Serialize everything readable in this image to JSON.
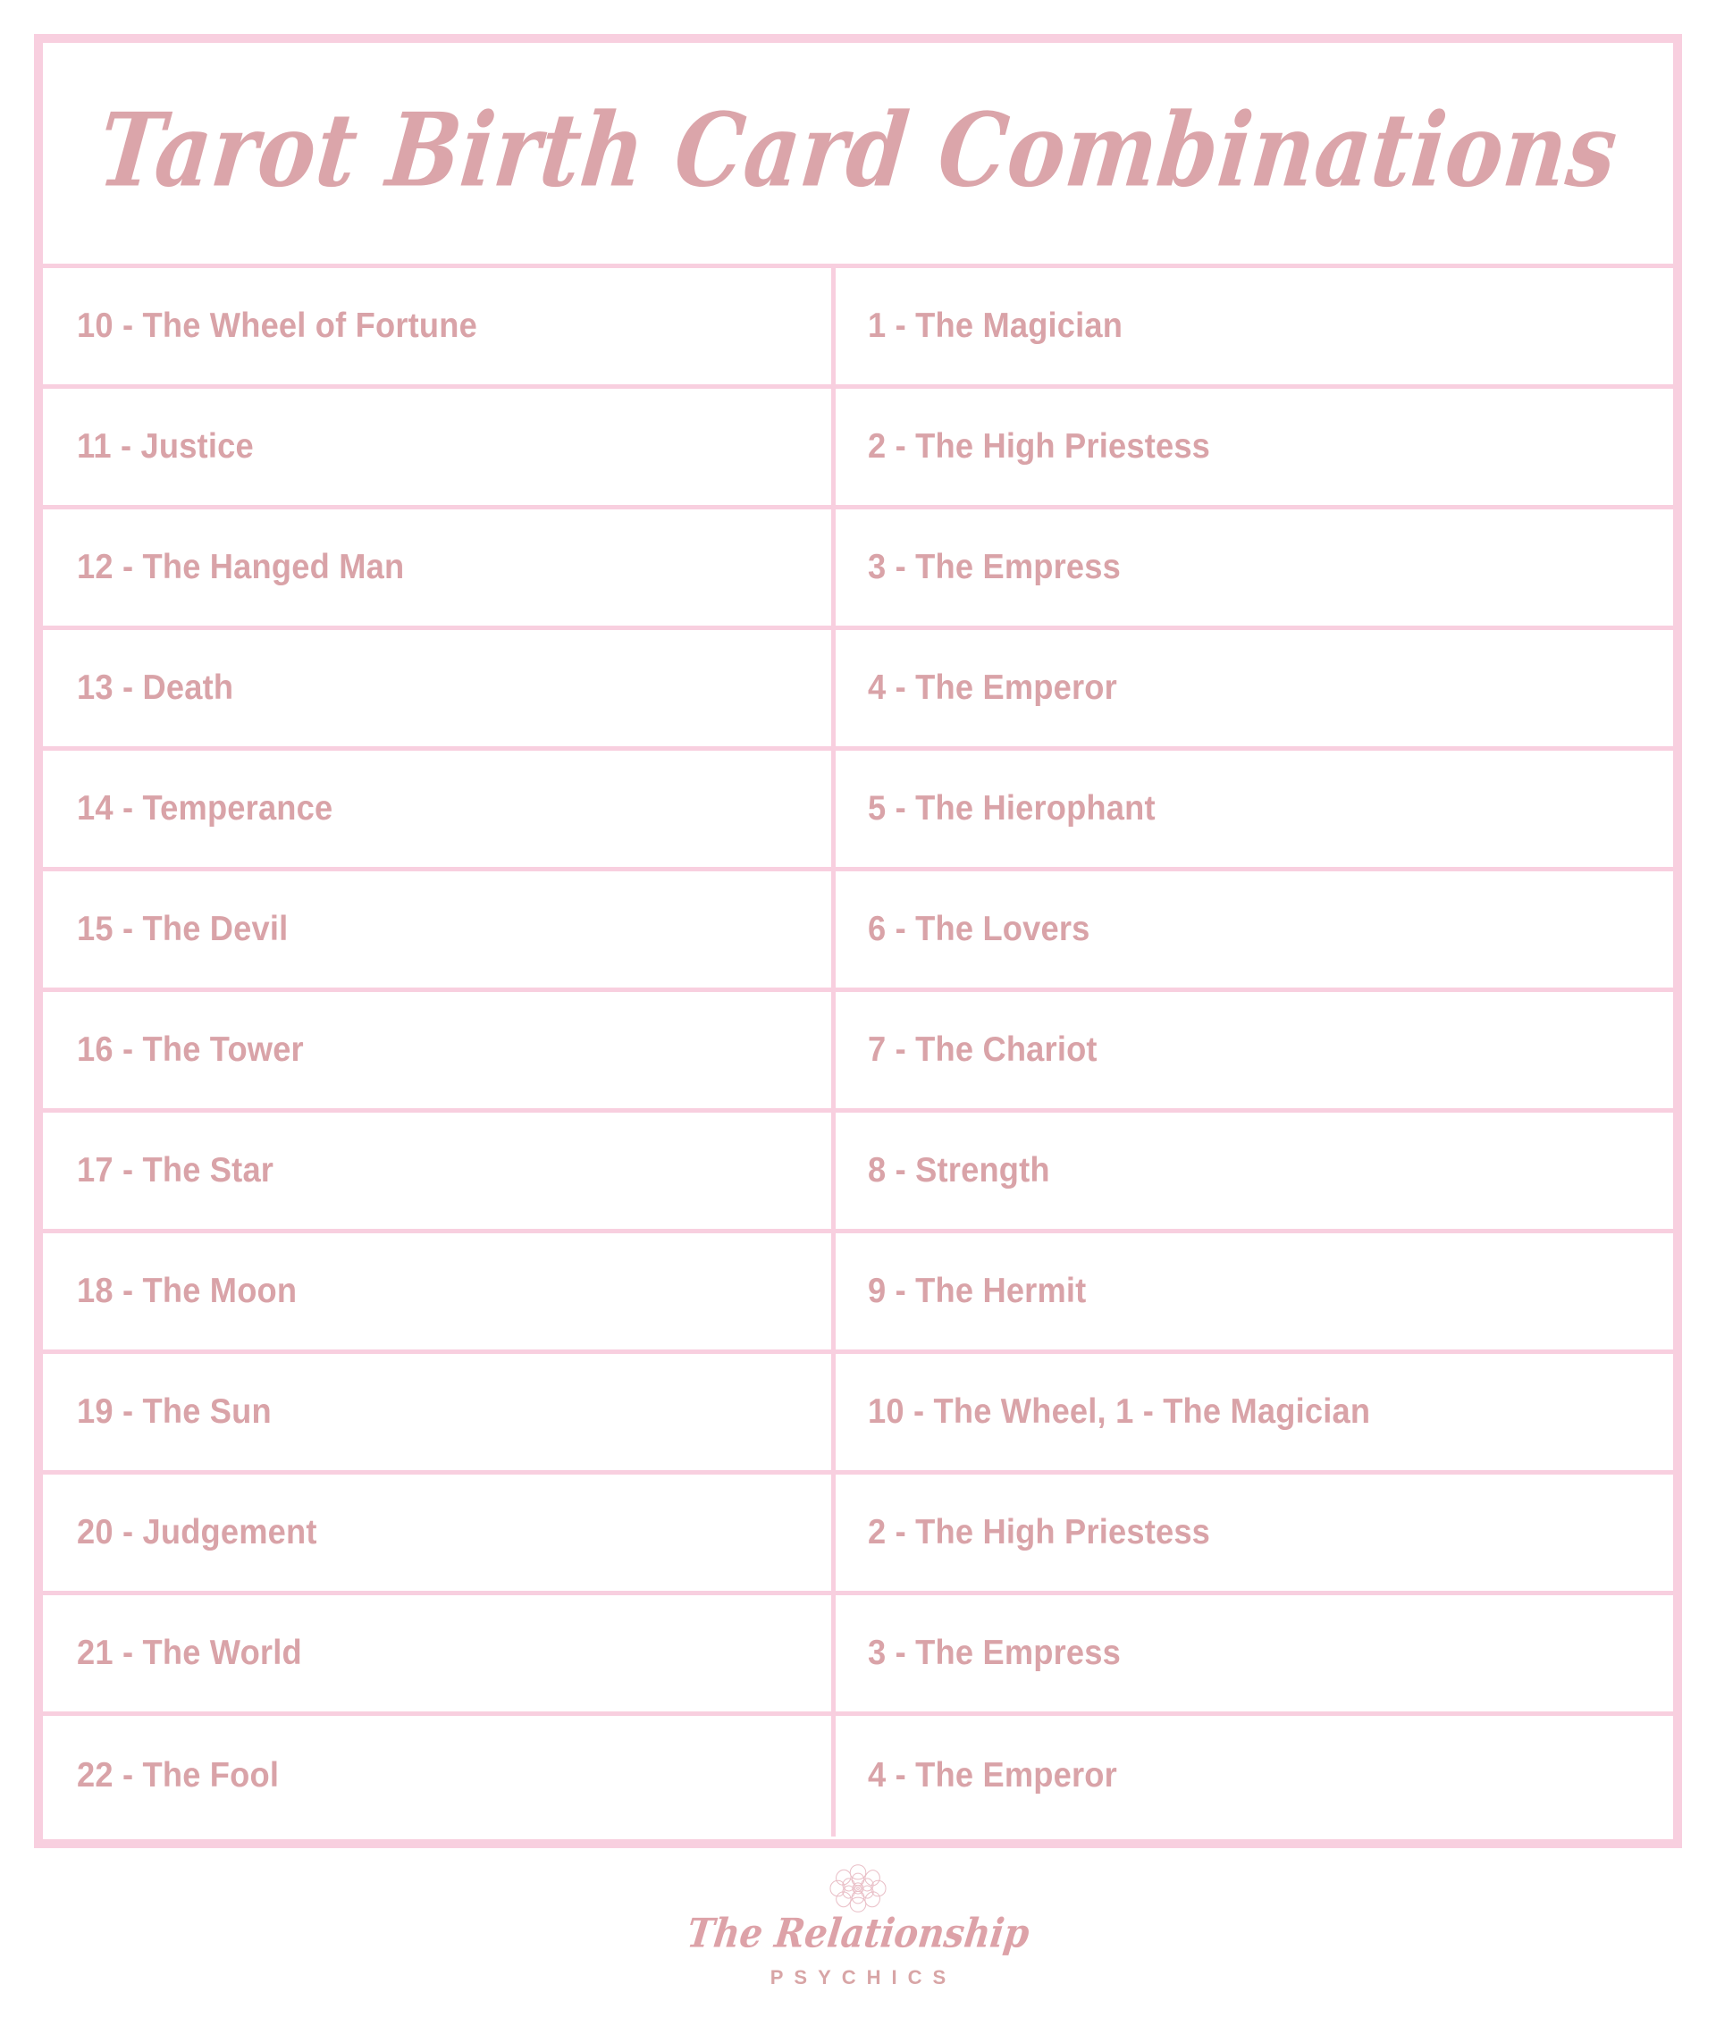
{
  "page": {
    "background_color": "#ffffff",
    "border_color": "#f8cfdf",
    "text_color": "#d9a3a8",
    "title": "Tarot Birth Card Combinations"
  },
  "table": {
    "rows": [
      {
        "left": "10 - The Wheel of Fortune",
        "right": "1 - The Magician"
      },
      {
        "left": "11 - Justice",
        "right": "2 - The High Priestess"
      },
      {
        "left": "12 - The Hanged Man",
        "right": "3 - The Empress"
      },
      {
        "left": "13 - Death",
        "right": "4 - The Emperor"
      },
      {
        "left": "14 - Temperance",
        "right": "5 - The Hierophant"
      },
      {
        "left": "15 - The Devil",
        "right": "6 - The Lovers"
      },
      {
        "left": "16 - The Tower",
        "right": "7 - The Chariot"
      },
      {
        "left": "17 - The Star",
        "right": "8 - Strength"
      },
      {
        "left": "18 - The Moon",
        "right": "9 - The Hermit"
      },
      {
        "left": "19 - The Sun",
        "right": "10 - The Wheel, 1 - The Magician"
      },
      {
        "left": "20 - Judgement",
        "right": "2 - The High Priestess"
      },
      {
        "left": "21 - The World",
        "right": "3 - The Empress"
      },
      {
        "left": "22 - The Fool",
        "right": "4 - The Emperor"
      }
    ]
  },
  "footer": {
    "logo_icon": "lotus-mandala-icon",
    "brand_script": "The Relationship",
    "brand_subtitle": "PSYCHICS",
    "brand_color": "#dda2a8"
  }
}
